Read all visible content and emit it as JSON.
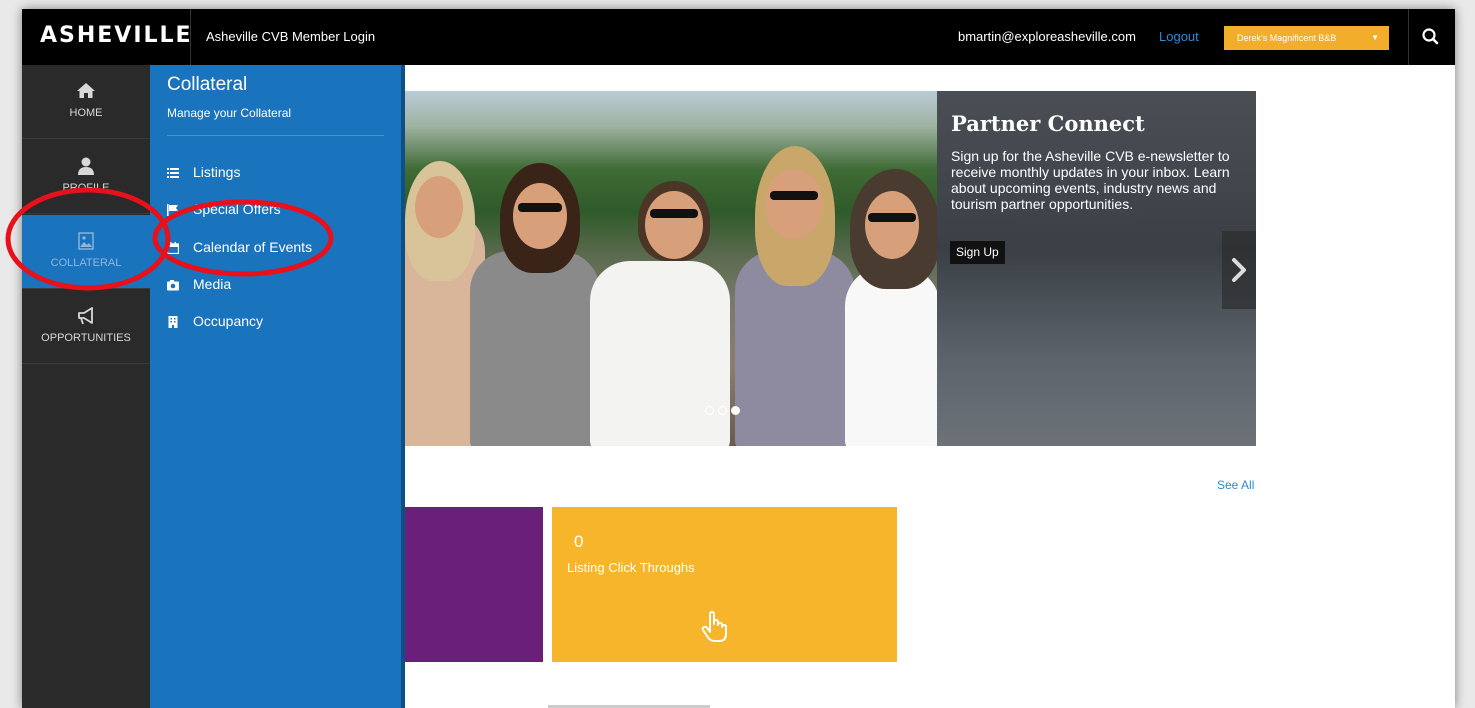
{
  "header": {
    "logo": "ASHEVILLE",
    "app_title": "Asheville CVB Member Login",
    "user_email": "bmartin@exploreasheville.com",
    "logout_label": "Logout",
    "property_selected": "Derek's Magnificent B&B",
    "search_icon": "search-icon"
  },
  "nav": {
    "items": [
      {
        "label": "HOME",
        "icon": "home-icon"
      },
      {
        "label": "PROFILE",
        "icon": "user-icon"
      },
      {
        "label": "COLLATERAL",
        "icon": "image-icon",
        "active": true
      },
      {
        "label": "OPPORTUNITIES",
        "icon": "megaphone-icon"
      }
    ]
  },
  "submenu": {
    "title": "Collateral",
    "description": "Manage your Collateral",
    "items": [
      {
        "label": "Listings",
        "icon": "list-icon"
      },
      {
        "label": "Special Offers",
        "icon": "flag-icon"
      },
      {
        "label": "Calendar of Events",
        "icon": "calendar-icon"
      },
      {
        "label": "Media",
        "icon": "camera-icon"
      },
      {
        "label": "Occupancy",
        "icon": "building-icon"
      }
    ]
  },
  "hero": {
    "title": "Partner Connect",
    "text": "Sign up for the Asheville CVB e-newsletter to receive monthly updates in your inbox. Learn about upcoming events, industry news and tourism partner opportunities.",
    "button_label": "Sign Up",
    "slides_total": 3,
    "slide_active": 3
  },
  "dashboard": {
    "see_all_label": "See All",
    "tiles": [
      {
        "color": "#6a1f7a"
      },
      {
        "count": "0",
        "label": "Listing Click Throughs",
        "icon": "pointer-hand-icon",
        "color": "#f7b52b"
      }
    ]
  },
  "colors": {
    "topbar": "#000000",
    "nav_bg": "#2a2a2a",
    "submenu_bg": "#1a73bd",
    "accent_orange": "#f2ae2b",
    "link_blue": "#2a8ad8",
    "annotation_red": "#e8101a"
  }
}
